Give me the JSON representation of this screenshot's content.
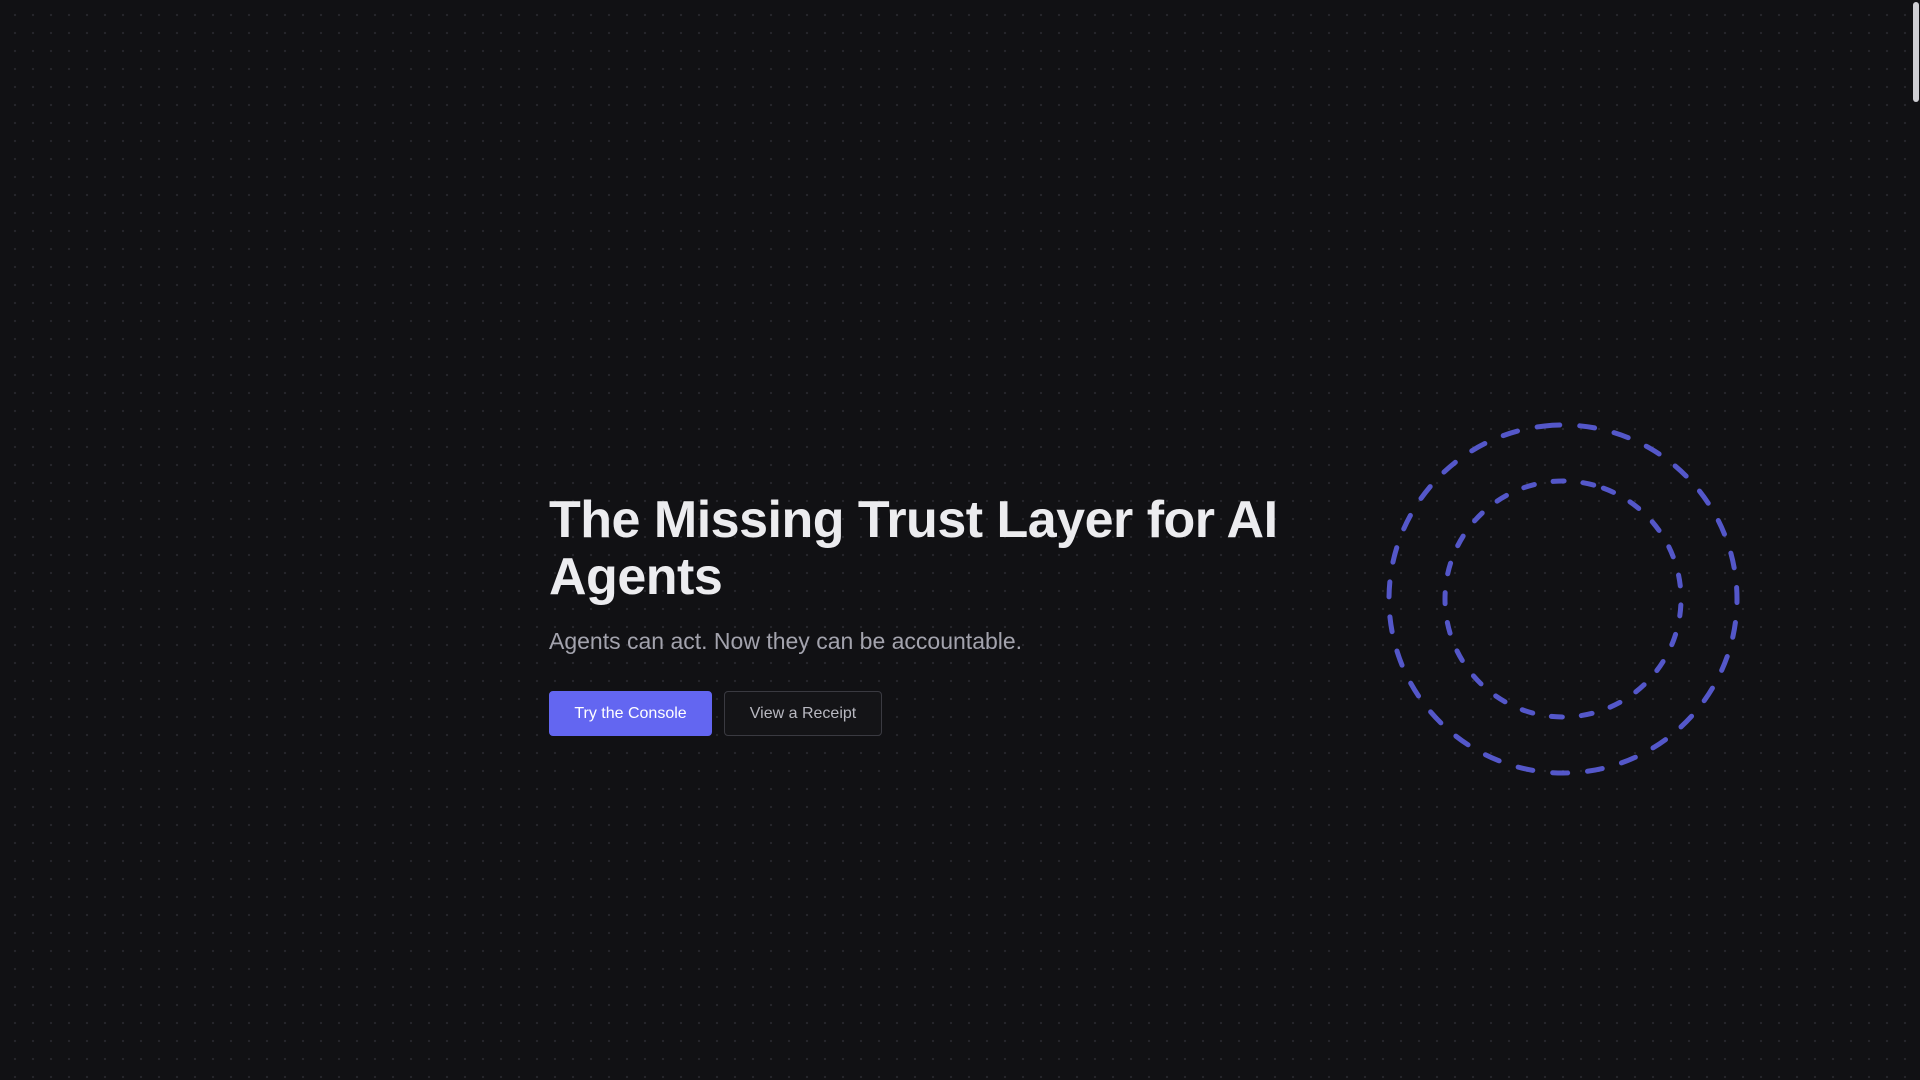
{
  "hero": {
    "title": "The Missing Trust Layer for AI Agents",
    "subtitle": "Agents can act. Now they can be accountable."
  },
  "actions": {
    "primary_label": "Try the Console",
    "secondary_label": "View a Receipt"
  },
  "decoration": {
    "icon": "dashed-concentric-rings-icon",
    "ring_color": "#6366f1"
  },
  "colors": {
    "background": "#111114",
    "accent": "#6366f1",
    "title": "#ececef",
    "subtitle": "#a3a3ad"
  }
}
